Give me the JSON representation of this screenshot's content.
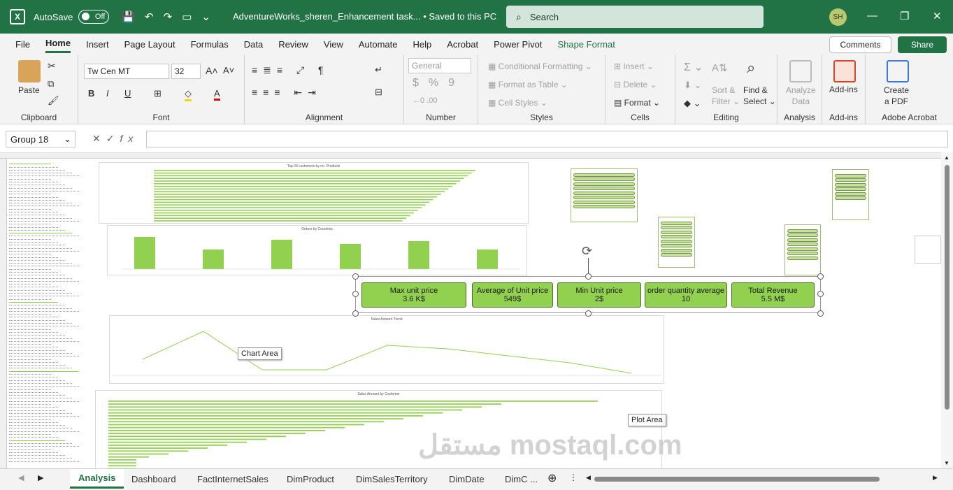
{
  "titlebar": {
    "app_icon": "excel-icon",
    "autosave_label": "AutoSave",
    "autosave_state": "Off",
    "doc_title": "AdventureWorks_sheren_Enhancement task...  •  Saved to this PC",
    "search_placeholder": "Search",
    "user_initials": "SH"
  },
  "menu": {
    "items": [
      "File",
      "Home",
      "Insert",
      "Page Layout",
      "Formulas",
      "Data",
      "Review",
      "View",
      "Automate",
      "Help",
      "Acrobat",
      "Power Pivot",
      "Shape Format"
    ],
    "active": "Home",
    "comments_label": "Comments",
    "share_label": "Share"
  },
  "ribbon": {
    "clipboard": {
      "paste": "Paste",
      "label": "Clipboard"
    },
    "font": {
      "name": "Tw Cen MT",
      "size": "32",
      "label": "Font"
    },
    "alignment": {
      "label": "Alignment"
    },
    "number": {
      "format": "General",
      "label": "Number"
    },
    "styles": {
      "conditional": "Conditional Formatting",
      "format_table": "Format as Table",
      "cell_styles": "Cell Styles",
      "label": "Styles"
    },
    "cells": {
      "insert": "Insert",
      "delete": "Delete",
      "format": "Format",
      "label": "Cells"
    },
    "editing": {
      "sort": "Sort &",
      "filter": "Filter",
      "find": "Find &",
      "select": "Select",
      "label": "Editing"
    },
    "analysis": {
      "analyze": "Analyze",
      "data": "Data",
      "label": "Analysis"
    },
    "addins": {
      "addins": "Add-ins",
      "label": "Add-ins"
    },
    "acrobat": {
      "create": "Create",
      "pdf": "a PDF",
      "label": "Adobe Acrobat"
    }
  },
  "formula_bar": {
    "name_box": "Group 18",
    "fx": "fx"
  },
  "charts": {
    "top_customers_title": "Top 20 customers by no. Products",
    "orders_country_title": "Orders by Countries",
    "sales_trend_title": "Sales Amount Trend",
    "sales_customer_title": "Sales Amount by Customer"
  },
  "kpis": [
    {
      "label": "Max unit price",
      "value": "3.6 K$"
    },
    {
      "label": "Average of Unit price",
      "value": "549$"
    },
    {
      "label": "Min Unit price",
      "value": "2$"
    },
    {
      "label": "order quantity average",
      "value": "10"
    },
    {
      "label": "Total Revenue",
      "value": "5.5 M$"
    }
  ],
  "tooltips": {
    "chart_area": "Chart Area",
    "plot_area": "Plot Area"
  },
  "tabs": [
    "Analysis",
    "Dashboard",
    "FactInternetSales",
    "DimProduct",
    "DimSalesTerritory",
    "DimDate",
    "DimC ..."
  ],
  "active_tab": "Analysis",
  "watermark": "مستقل mostaql.com",
  "colors": {
    "excel_green": "#217346",
    "kpi_fill": "#92d050",
    "bar_green": "#92d050"
  }
}
